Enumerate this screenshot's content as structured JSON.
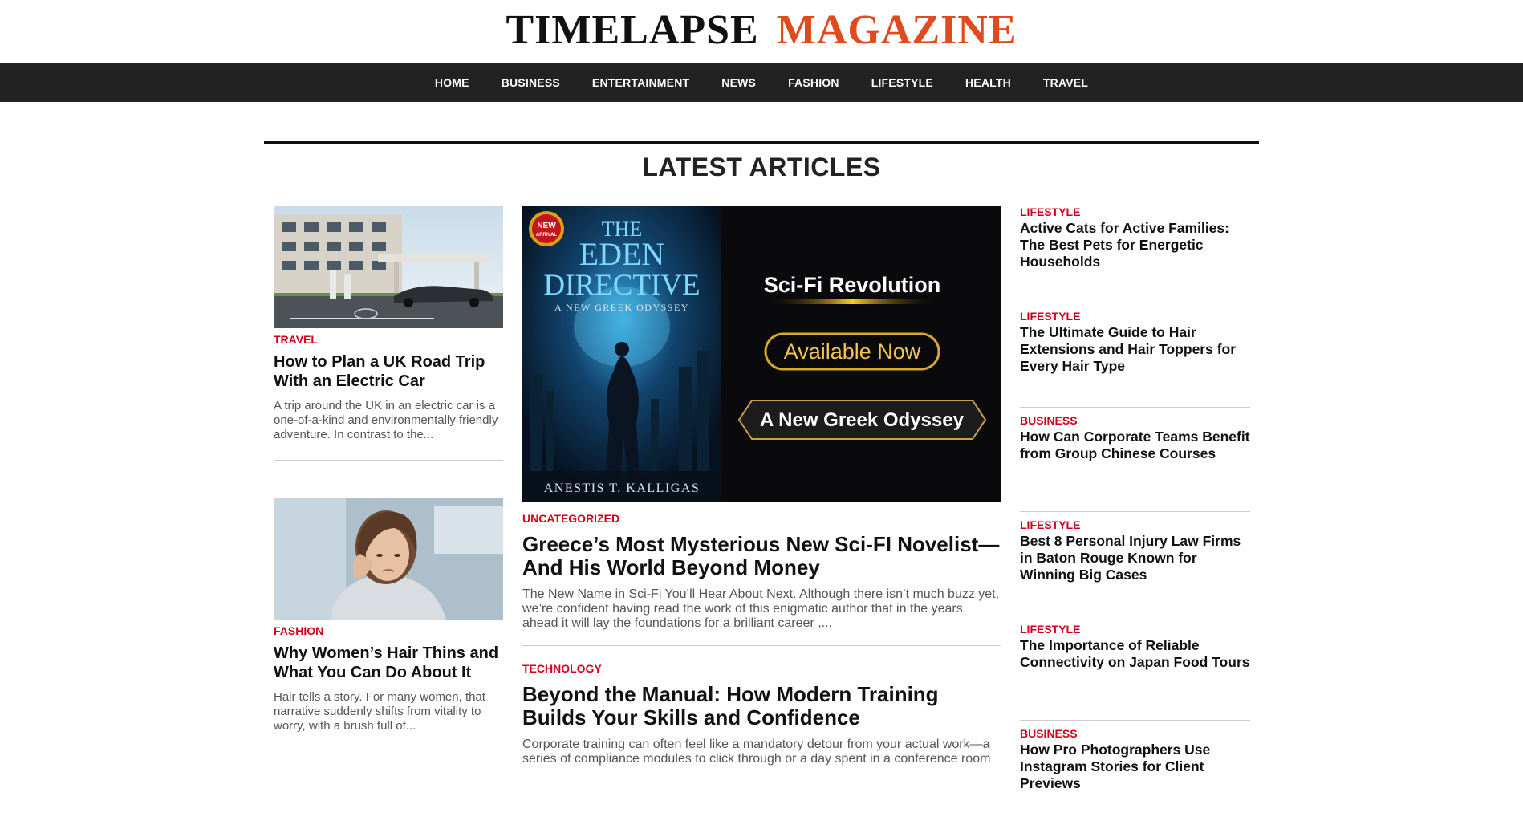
{
  "brand": {
    "part1": "TIMELAPSE",
    "part2": "MAGAZINE"
  },
  "nav": [
    "HOME",
    "BUSINESS",
    "ENTERTAINMENT",
    "NEWS",
    "FASHION",
    "LIFESTYLE",
    "HEALTH",
    "TRAVEL"
  ],
  "section_title": "LATEST ARTICLES",
  "left": [
    {
      "category": "TRAVEL",
      "headline": "How to Plan a UK Road Trip With an Electric Car",
      "excerpt": "A trip around the UK in an electric car is a one-of-a-kind and environmentally friendly adventure. In contrast to the..."
    },
    {
      "category": "FASHION",
      "headline": "Why Women’s Hair Thins and What You Can Do About It",
      "excerpt": "Hair tells a story. For many women, that narrative suddenly shifts from vitality to worry, with a brush full of..."
    }
  ],
  "hero": {
    "badge_line1": "NEW",
    "badge_line2": "ARRIVAL",
    "book_title_1": "THE",
    "book_title_2": "EDEN",
    "book_title_3": "DIRECTIVE",
    "book_subtitle": "A NEW GREEK ODYSSEY",
    "book_author": "ANESTIS T. KALLIGAS",
    "tag1": "Sci-Fi Revolution",
    "tag2": "Available Now",
    "tag3": "A New Greek Odyssey"
  },
  "middle": [
    {
      "category": "UNCATEGORIZED",
      "headline": "Greece’s Most Mysterious New Sci-FI Novelist—And His World Beyond Money",
      "excerpt": "The New Name in Sci-Fi You’ll Hear About Next. Although there isn’t much buzz yet, we’re confident having read the work of this enigmatic author that in the years ahead it will lay the foundations for a brilliant career ,..."
    },
    {
      "category": "TECHNOLOGY",
      "headline": "Beyond the Manual: How Modern Training Builds Your Skills and Confidence",
      "excerpt": "Corporate training can often feel like a mandatory detour from your actual work—a series of compliance modules to click through or a day spent in a conference room"
    }
  ],
  "right": [
    {
      "category": "LIFESTYLE",
      "headline": "Active Cats for Active Families: The Best Pets for Energetic Households"
    },
    {
      "category": "LIFESTYLE",
      "headline": "The Ultimate Guide to Hair Extensions and Hair Toppers for Every Hair Type"
    },
    {
      "category": "BUSINESS",
      "headline": "How Can Corporate Teams Benefit from Group Chinese Courses"
    },
    {
      "category": "LIFESTYLE",
      "headline": "Best 8 Personal Injury Law Firms in Baton Rouge Known for Winning Big Cases"
    },
    {
      "category": "LIFESTYLE",
      "headline": "The Importance of Reliable Connectivity on Japan Food Tours"
    },
    {
      "category": "BUSINESS",
      "headline": "How Pro Photographers Use Instagram Stories for Client Previews"
    }
  ]
}
